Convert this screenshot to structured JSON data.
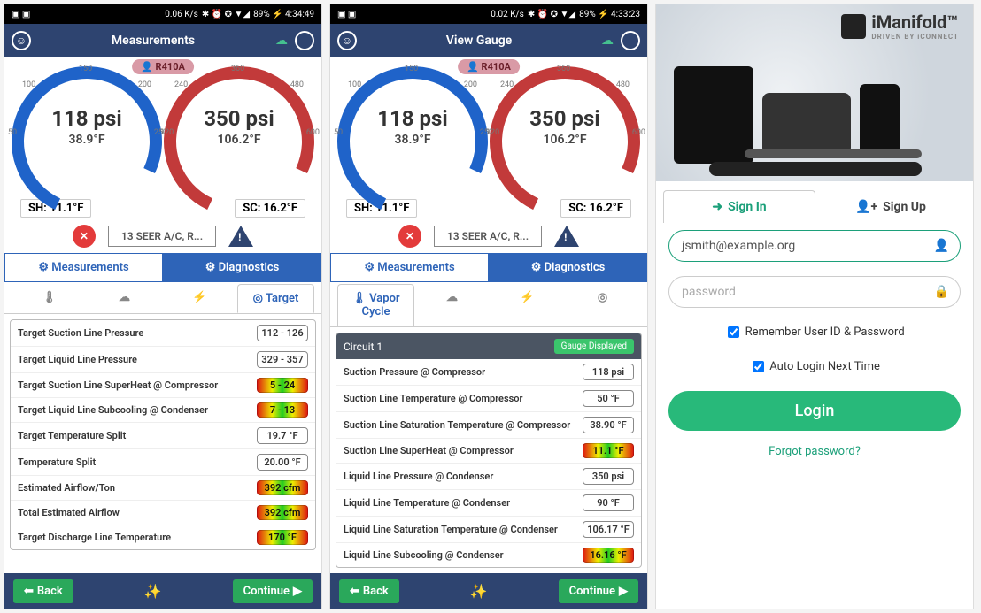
{
  "status": {
    "net1": "0.06 K/s",
    "net2": "0.02 K/s",
    "batt1": "89% ⚡ 4:34:49",
    "batt2": "89% ⚡ 4:33:23"
  },
  "header": {
    "title1": "Measurements",
    "title2": "View Gauge"
  },
  "refrigerant": "R410A",
  "gauge": {
    "left_pressure": "118 psi",
    "left_temp": "38.9°F",
    "sh": "SH: 11.1°F",
    "right_pressure": "350 psi",
    "right_temp": "106.2°F",
    "sc": "SC: 16.2°F",
    "bticks": [
      "50",
      "100",
      "150",
      "200",
      "250"
    ],
    "rticks": [
      "120",
      "240",
      "360",
      "480",
      "600"
    ]
  },
  "seer": "13 SEER A/C, R...",
  "tabs": {
    "a": "Measurements",
    "b": "Diagnostics"
  },
  "sub1": {
    "active": "Target"
  },
  "sub2": {
    "active": "Vapor Cycle"
  },
  "target_rows": [
    {
      "label": "Target Suction Line Pressure",
      "val": "112 - 126",
      "grad": false
    },
    {
      "label": "Target Liquid Line Pressure",
      "val": "329 - 357",
      "grad": false
    },
    {
      "label": "Target Suction Line SuperHeat @ Compressor",
      "val": "5 - 24",
      "grad": true
    },
    {
      "label": "Target Liquid Line Subcooling @ Condenser",
      "val": "7 - 13",
      "grad": true
    },
    {
      "label": "Target Temperature Split",
      "val": "19.7 °F",
      "grad": false
    },
    {
      "label": "Temperature Split",
      "val": "20.00 °F",
      "grad": false
    },
    {
      "label": "Estimated Airflow/Ton",
      "val": "392 cfm",
      "grad": true
    },
    {
      "label": "Total Estimated Airflow",
      "val": "392 cfm",
      "grad": true
    },
    {
      "label": "Target Discharge Line Temperature",
      "val": "170 °F",
      "grad": true
    }
  ],
  "circuit": {
    "name": "Circuit 1",
    "pill": "Gauge Displayed"
  },
  "vapor_rows": [
    {
      "label": "Suction Pressure @ Compressor",
      "val": "118 psi",
      "grad": false
    },
    {
      "label": "Suction Line Temperature @ Compressor",
      "val": "50 °F",
      "grad": false
    },
    {
      "label": "Suction Line Saturation Temperature @ Compressor",
      "val": "38.90 °F",
      "grad": false
    },
    {
      "label": "Suction Line SuperHeat @ Compressor",
      "val": "11.1 °F",
      "grad": true
    },
    {
      "label": "Liquid Line Pressure @ Condenser",
      "val": "350 psi",
      "grad": false
    },
    {
      "label": "Liquid Line Temperature @ Condenser",
      "val": "90 °F",
      "grad": false
    },
    {
      "label": "Liquid Line Saturation Temperature @ Condenser",
      "val": "106.17 °F",
      "grad": false
    },
    {
      "label": "Liquid Line Subcooling @ Condenser",
      "val": "16.16 °F",
      "grad": true
    }
  ],
  "footer": {
    "back": "Back",
    "cont": "Continue"
  },
  "login": {
    "brand": "iManifold",
    "sub": "DRIVEN BY iCONNECT",
    "signin": "Sign In",
    "signup": "Sign Up",
    "email": "jsmith@example.org",
    "pw_placeholder": "password",
    "remember": "Remember User ID & Password",
    "auto": "Auto Login Next Time",
    "btn": "Login",
    "forgot": "Forgot password?"
  }
}
